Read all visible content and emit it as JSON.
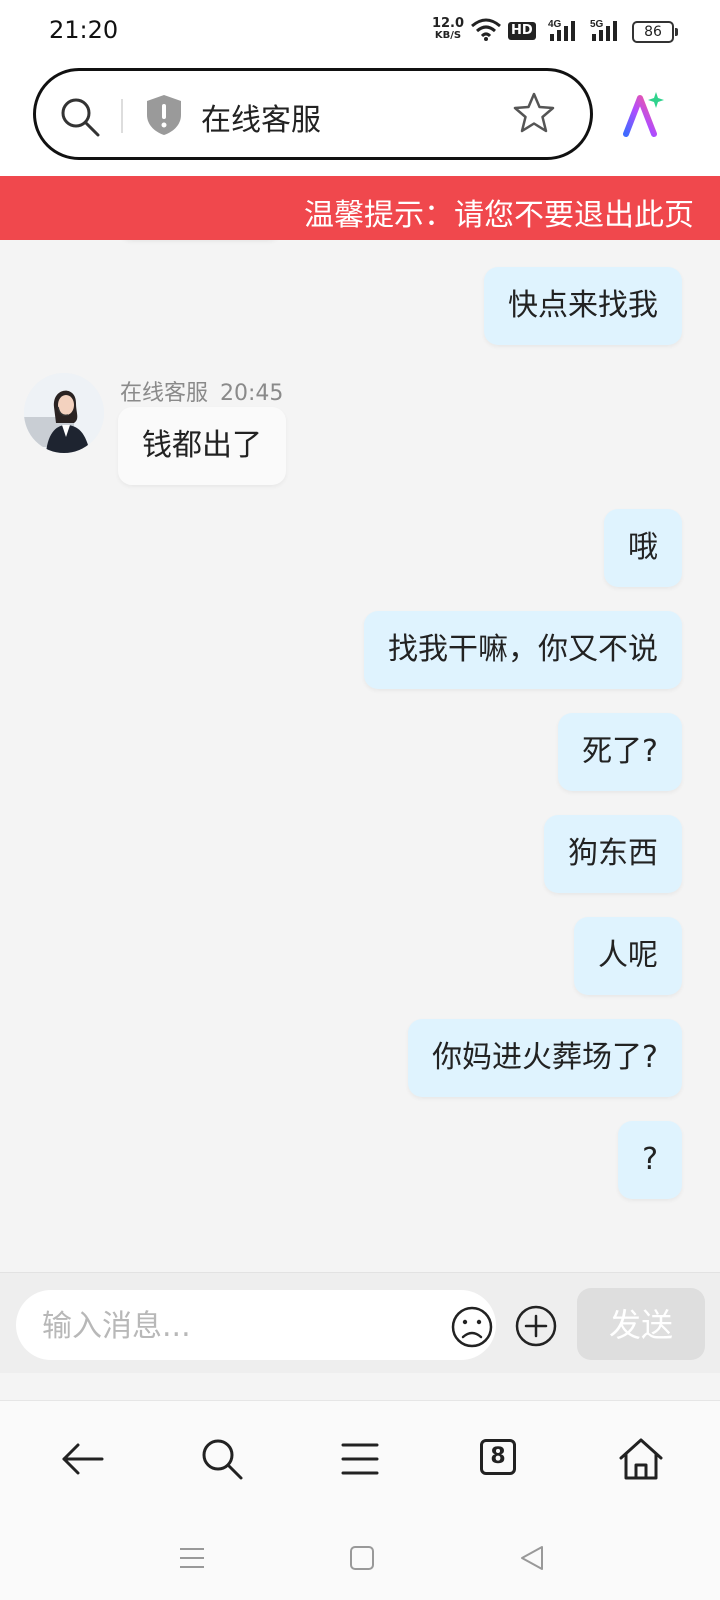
{
  "status_bar": {
    "time": "21:20",
    "net_speed_value": "12.0",
    "net_speed_unit": "KB/S",
    "hd_label": "HD",
    "signal1_label": "4G",
    "signal2_label": "5G",
    "battery": "86"
  },
  "address_bar": {
    "page_title": "在线客服",
    "icons": [
      "search-icon",
      "shield-alert-icon",
      "star-icon",
      "ai-assistant-icon"
    ]
  },
  "banner": {
    "text": "温馨提示：请您不要退出此页"
  },
  "chat": {
    "agent_name": "在线客服",
    "agent_time": "20:45",
    "messages": [
      {
        "from": "me",
        "text": "快点来找我"
      },
      {
        "from": "agent",
        "text": "钱都出了"
      },
      {
        "from": "me",
        "text": "哦"
      },
      {
        "from": "me",
        "text": "找我干嘛，你又不说"
      },
      {
        "from": "me",
        "text": "死了?"
      },
      {
        "from": "me",
        "text": "狗东西"
      },
      {
        "from": "me",
        "text": "人呢"
      },
      {
        "from": "me",
        "text": "你妈进火葬场了?"
      },
      {
        "from": "me",
        "text": "?"
      }
    ]
  },
  "input_bar": {
    "placeholder": "输入消息...",
    "send_label": "发送"
  },
  "browser_nav": {
    "tab_count": "8",
    "icons": [
      "back-arrow-icon",
      "search-icon",
      "menu-icon",
      "tabs-icon",
      "home-icon"
    ]
  },
  "system_nav": {
    "icons": [
      "recent-apps-icon",
      "home-square-icon",
      "back-triangle-icon"
    ]
  },
  "colors": {
    "banner_bg": "#f0484d",
    "my_bubble_bg": "#dff3fe",
    "agent_bubble_bg": "#fafafa",
    "send_button_bg": "#dedede"
  }
}
